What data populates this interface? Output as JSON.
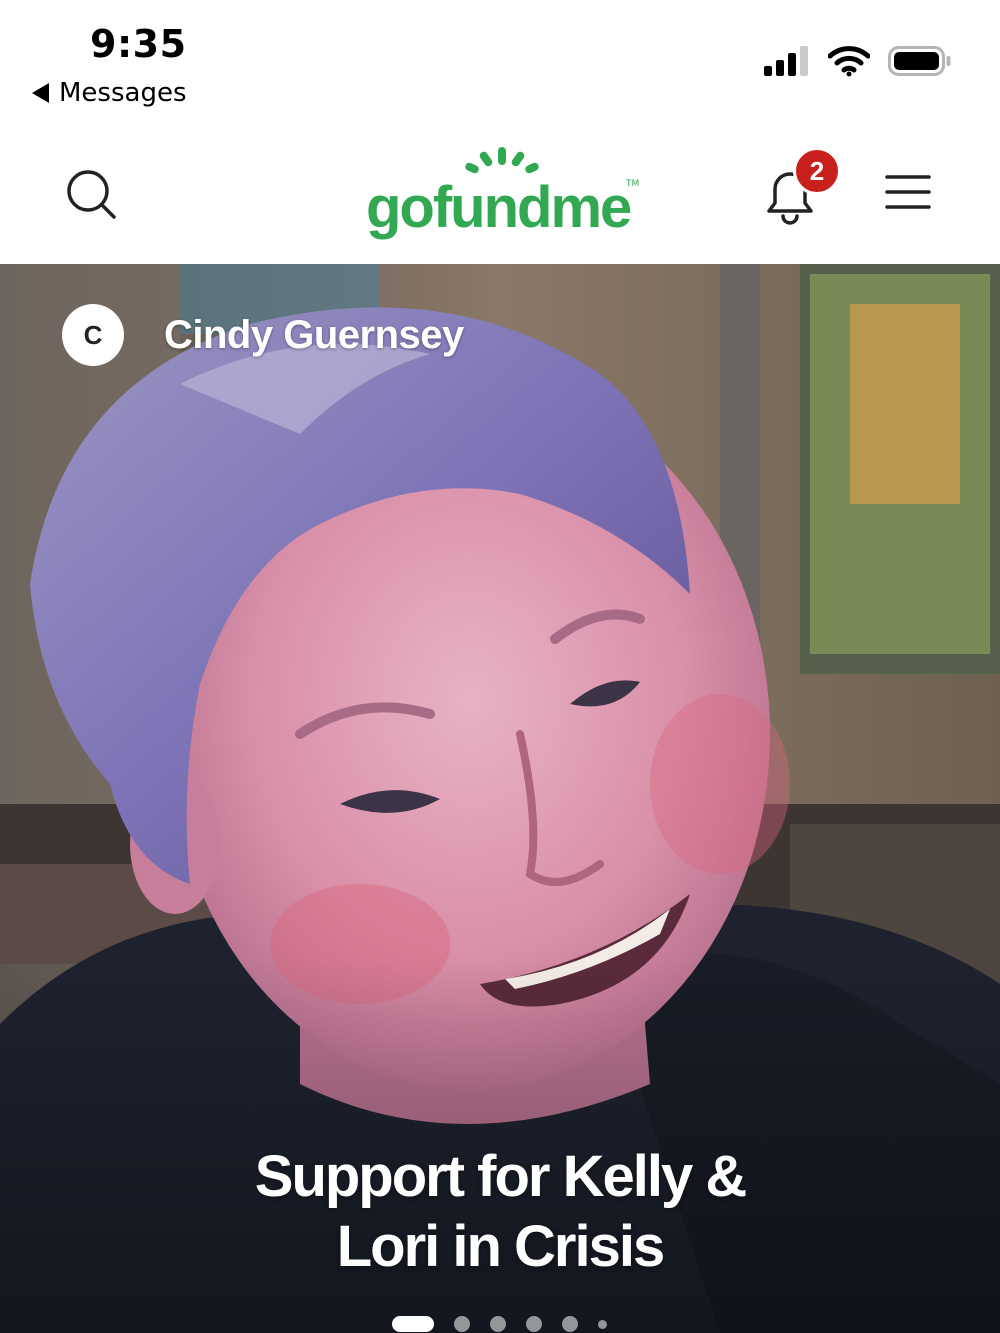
{
  "status_bar": {
    "time": "9:35",
    "back_label": "Messages"
  },
  "header": {
    "logo_text": "gofundme",
    "logo_tm": "TM",
    "notification_count": "2",
    "brand_color": "#32a852",
    "badge_color": "#c8201c"
  },
  "hero": {
    "organizer_initial": "C",
    "organizer_name": "Cindy Guernsey",
    "title_line1": "Support for Kelly &",
    "title_line2": "Lori in Crisis",
    "carousel_current": 1,
    "carousel_dots_visible": 6
  }
}
